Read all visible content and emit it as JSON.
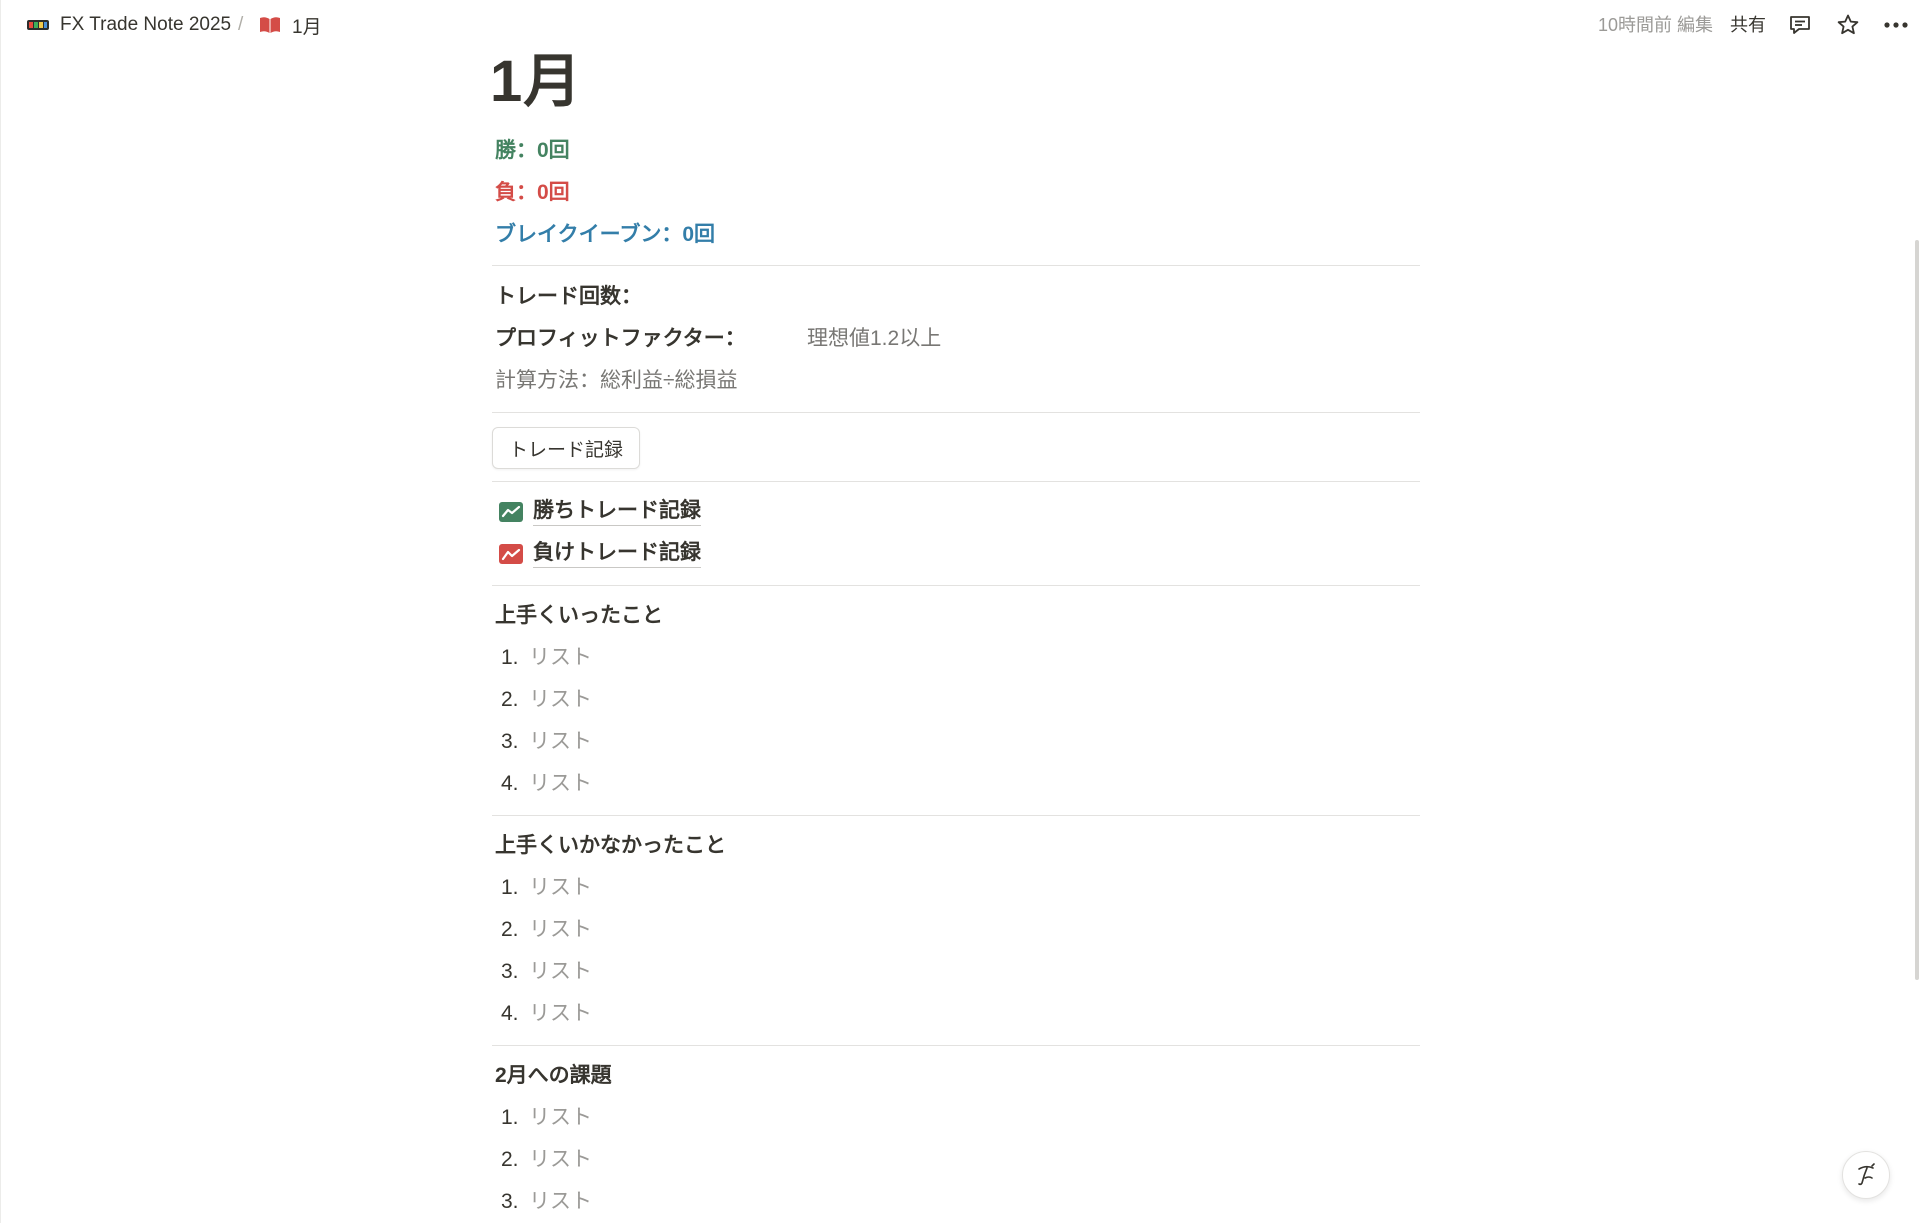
{
  "breadcrumb": {
    "workspace": "FX Trade Note 2025",
    "separator": "/",
    "page": "1月"
  },
  "header": {
    "edited": "10時間前 編集",
    "share": "共有",
    "icons": [
      "comment-icon",
      "star-icon",
      "more-icon"
    ]
  },
  "page": {
    "title": "1月",
    "stats": {
      "win": "勝：0回",
      "loss": "負：0回",
      "breakeven": "ブレイクイーブン：0回"
    },
    "metrics": {
      "trade_count": "トレード回数：",
      "profit_factor": "プロフィットファクター：",
      "profit_factor_note": "理想値1.2以上",
      "calc_method": "計算方法：総利益÷総損益"
    },
    "trade_button": "トレード記録",
    "links": [
      {
        "label": "勝ちトレード記録",
        "icon": "chart-up-green-icon",
        "color": "#448361"
      },
      {
        "label": "負けトレード記録",
        "icon": "chart-down-red-icon",
        "color": "#d44c47"
      }
    ],
    "sections": [
      {
        "heading": "上手くいったこと",
        "items": [
          {
            "num": "1.",
            "text": "リスト"
          },
          {
            "num": "2.",
            "text": "リスト"
          },
          {
            "num": "3.",
            "text": "リスト"
          },
          {
            "num": "4.",
            "text": "リスト"
          }
        ]
      },
      {
        "heading": "上手くいかなかったこと",
        "items": [
          {
            "num": "1.",
            "text": "リスト"
          },
          {
            "num": "2.",
            "text": "リスト"
          },
          {
            "num": "3.",
            "text": "リスト"
          },
          {
            "num": "4.",
            "text": "リスト"
          }
        ]
      },
      {
        "heading": "2月への課題",
        "items": [
          {
            "num": "1.",
            "text": "リスト"
          },
          {
            "num": "2.",
            "text": "リスト"
          },
          {
            "num": "3.",
            "text": "リスト"
          }
        ]
      }
    ]
  },
  "colors": {
    "green": "#448361",
    "red": "#d44c47",
    "blue": "#337ea9",
    "text": "#37352f",
    "muted": "#9b9a97"
  }
}
